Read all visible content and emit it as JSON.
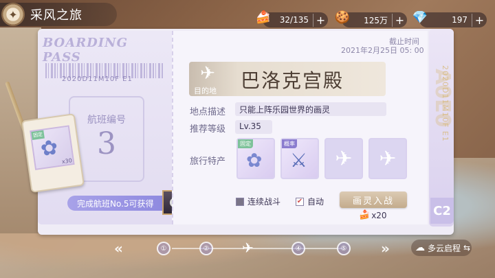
{
  "header": {
    "title": "采风之旅",
    "resources": [
      {
        "icon": "cake-icon",
        "glyph": "🍰",
        "value": "32/135"
      },
      {
        "icon": "macaron-icon",
        "glyph": "🍪",
        "value": "125万"
      },
      {
        "icon": "gem-icon",
        "glyph": "💎",
        "value": "197"
      }
    ]
  },
  "ticket": {
    "heading": "BOARDING PASS",
    "barcode_text": "2020D11M10F E1",
    "flight_label": "航班编号",
    "flight_number": "3",
    "deadline_label": "截止时间",
    "deadline_time": "2021年2月25日 05: 00",
    "destination_label": "目的地",
    "destination_name": "巴洛克宫殿",
    "location_label": "地点描述",
    "location_value": "只能上阵乐园世界的画灵",
    "level_label": "推荐等级",
    "level_value": "Lv.35",
    "specialty_label": "旅行特产",
    "specialty_badge_fixed": "固定",
    "specialty_badge_chance": "概率",
    "tag_badge": "固定",
    "tag_count": "x30",
    "reward_text": "完成航班No.5可获得",
    "stub_text": "2020D11M10F E1",
    "stub_code": "C2",
    "continuous_label": "连续战斗",
    "auto_label": "自动",
    "start_button": "画灵入战",
    "cost": "x20"
  },
  "nav": {
    "dots": [
      "①",
      "②",
      "④",
      "⑤"
    ],
    "weather": "多云启程"
  }
}
